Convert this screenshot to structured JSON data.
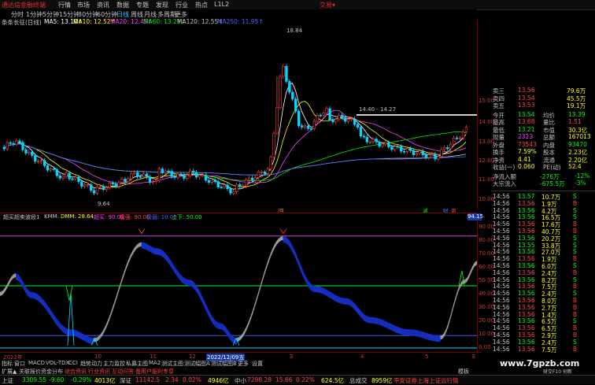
{
  "app": {
    "logo": "通达信金融终端",
    "menu": [
      "行情",
      "市场",
      "资讯",
      "数据",
      "专题",
      "发现",
      "行业",
      "热点",
      "L1L2"
    ],
    "account": "交易▾"
  },
  "periods": [
    "分时",
    "1分钟",
    "5分钟",
    "15分钟",
    "30分钟",
    "60分钟",
    "日线",
    "周线",
    "月线",
    "多周期",
    "更多"
  ],
  "selected_period": "日线",
  "chart_title": "条条长征(日线)",
  "ma_legend": [
    {
      "label": "MA5: 13.10↑",
      "color": "#ffffff"
    },
    {
      "label": "MA10: 12.52↑",
      "color": "#ffff00"
    },
    {
      "label": "MA20: 12.45↑",
      "color": "#ff44ff"
    },
    {
      "label": "MA60: 13.29↓",
      "color": "#00ee00"
    },
    {
      "label": "MA120: 12.55↑",
      "color": "#c0c0c0"
    },
    {
      "label": "MA250: 11.95↑",
      "color": "#4466ff"
    }
  ],
  "price_axis": [
    "15.00",
    "14.00",
    "13.00",
    "12.00",
    "11.00",
    "10.00"
  ],
  "price_annotations": {
    "high": "18.84",
    "low": "9.64",
    "range": "14.40 - 14.27"
  },
  "event_marks": [
    "回",
    "減",
    "财",
    "周"
  ],
  "indicator_header": {
    "name": "超买超卖波段1",
    "kmm": "KMM: ",
    "dmm": "DMM: 28.64",
    "overbought": "超买: 90.00",
    "strong": "极强: 90.00",
    "weak": "极弱: 10.00",
    "rise": "上下: 50.00",
    "value_badge": "94.15"
  },
  "indicator_axis": [
    "90.00",
    "80.00",
    "70.00",
    "60.00",
    "50.00",
    "40.00",
    "30.00",
    "20.00",
    "10.00",
    "0.00"
  ],
  "time_axis": [
    "2022年",
    "10",
    "11",
    "12",
    "2022/12/09五",
    "3",
    "4",
    "5",
    "E"
  ],
  "quote": {
    "sell_levels": [
      [
        "卖三",
        "13.56",
        "79.6万"
      ],
      [
        "卖四",
        "13.54",
        "45.5万"
      ],
      [
        "卖五",
        "13.53",
        "19.1万"
      ]
    ],
    "rows": [
      [
        {
          "t": "今开",
          "c": "#c0c0c0"
        },
        {
          "t": "13.54",
          "c": "#00ff00"
        },
        {
          "t": "均价",
          "c": "#c0c0c0"
        },
        {
          "t": "13.39",
          "c": "#00ff00"
        }
      ],
      [
        {
          "t": "最高",
          "c": "#c0c0c0"
        },
        {
          "t": "13.68",
          "c": "#ff4040"
        },
        {
          "t": "量比",
          "c": "#c0c0c0"
        },
        {
          "t": "1.51",
          "c": "#ff4040"
        }
      ],
      [
        {
          "t": "最低",
          "c": "#c0c0c0"
        },
        {
          "t": "13.21",
          "c": "#00ff00"
        },
        {
          "t": "市值",
          "c": "#c0c0c0"
        },
        {
          "t": "30.3亿",
          "c": "#ffff00"
        }
      ],
      [
        {
          "t": "现量",
          "c": "#c0c0c0"
        },
        {
          "t": "2323",
          "c": "#ff44ff"
        },
        {
          "t": "总额",
          "c": "#c0c0c0"
        },
        {
          "t": "167013",
          "c": "#ffff00"
        }
      ],
      [
        {
          "t": "外盘",
          "c": "#c0c0c0"
        },
        {
          "t": "73543",
          "c": "#ff4040"
        },
        {
          "t": "内盘",
          "c": "#c0c0c0"
        },
        {
          "t": "93470",
          "c": "#00ff00"
        }
      ],
      [
        {
          "t": "换手",
          "c": "#c0c0c0"
        },
        {
          "t": "7.59%",
          "c": "#ffff00"
        },
        {
          "t": "股本",
          "c": "#c0c0c0"
        },
        {
          "t": "2.23亿",
          "c": "#ffff00"
        }
      ],
      [
        {
          "t": "净资",
          "c": "#c0c0c0"
        },
        {
          "t": "4.41",
          "c": "#ffff00"
        },
        {
          "t": "流通",
          "c": "#c0c0c0"
        },
        {
          "t": "2.20亿",
          "c": "#ffff00"
        }
      ],
      [
        {
          "t": "收益(一)",
          "c": "#c0c0c0"
        },
        {
          "t": "0.060",
          "c": "#ffff00"
        },
        {
          "t": "PE(动)",
          "c": "#c0c0c0"
        },
        {
          "t": "52.4",
          "c": "#ffff00"
        }
      ]
    ],
    "net_inflow": [
      [
        "净流入额",
        "-276万",
        "-12%"
      ],
      [
        "大宗流入",
        "-675.5万",
        "-3%"
      ]
    ]
  },
  "trades": [
    [
      "14:56",
      "13.57",
      "10.7万",
      "S"
    ],
    [
      "14:56",
      "13.56",
      "1.9万",
      "B"
    ],
    [
      "14:56",
      "13.56",
      "4.2万",
      "S"
    ],
    [
      "14:56",
      "13.56",
      "16.5万",
      "S"
    ],
    [
      "14:56",
      "13.56",
      "17.6万",
      "B"
    ],
    [
      "14:56",
      "13.56",
      "40.7万",
      "B"
    ],
    [
      "14:56",
      "13.56",
      "20.2万",
      "S"
    ],
    [
      "14:56",
      "13.55",
      "33.8万",
      "S"
    ],
    [
      "14:56",
      "13.56",
      "27.0万",
      "S"
    ],
    [
      "14:56",
      "13.56",
      "1.9万",
      "B"
    ],
    [
      "14:56",
      "13.56",
      "6.0万",
      "S"
    ],
    [
      "14:56",
      "13.56",
      "2.4万",
      "B"
    ],
    [
      "14:56",
      "13.56",
      "8.2万",
      "S"
    ],
    [
      "14:56",
      "13.56",
      "7.5万",
      "B"
    ],
    [
      "14:56",
      "13.56",
      "2.4万",
      "S"
    ],
    [
      "14:56",
      "13.56",
      "8.0万",
      "B"
    ],
    [
      "14:56",
      "13.56",
      "2.7万",
      "B"
    ],
    [
      "14:56",
      "13.56",
      "1.4万",
      "B"
    ],
    [
      "14:56",
      "13.56",
      "6.5万",
      "S"
    ],
    [
      "14:56",
      "13.56",
      "6.5万",
      "B"
    ],
    [
      "14:56",
      "13.56",
      "2.9万",
      "B"
    ],
    [
      "14:56",
      "13.56",
      "2.4万",
      "S"
    ],
    [
      "14:56",
      "13.56",
      "7.5万",
      "B"
    ]
  ],
  "tabs": [
    "指标",
    "窗口",
    "MACD",
    "VOL-TDX",
    "CCI",
    "趋势动力",
    "主力监控",
    "私募主图",
    "MA2",
    "测试主图",
    "测试幅图A",
    "测试幅图B",
    "更多",
    "设置"
  ],
  "bottom_tabs": [
    "扩展▲",
    "关联报价",
    "资金分布",
    "综合资讯",
    "行业资讯",
    "互动问答",
    "备用户服利专享"
  ],
  "corner_text": "模板",
  "status": [
    {
      "label": "上证",
      "value": "3309.55",
      "change": "-9.60",
      "pct": "-0.29%",
      "amount": "4013亿"
    },
    {
      "label": "深证",
      "value": "11142.5",
      "change": "2.34",
      "pct": "0.02%",
      "amount": "4946亿"
    },
    {
      "label": "中小",
      "value": "7298.28",
      "change": "15.66",
      "pct": "0.22%",
      "amount": "624.5亿"
    },
    {
      "label": "总成交",
      "value": "8959亿"
    }
  ],
  "status_tail": "平安证券上海上证云行情",
  "watermark": "www.7gpzb.com",
  "badge_text": "财交F10 创新"
}
